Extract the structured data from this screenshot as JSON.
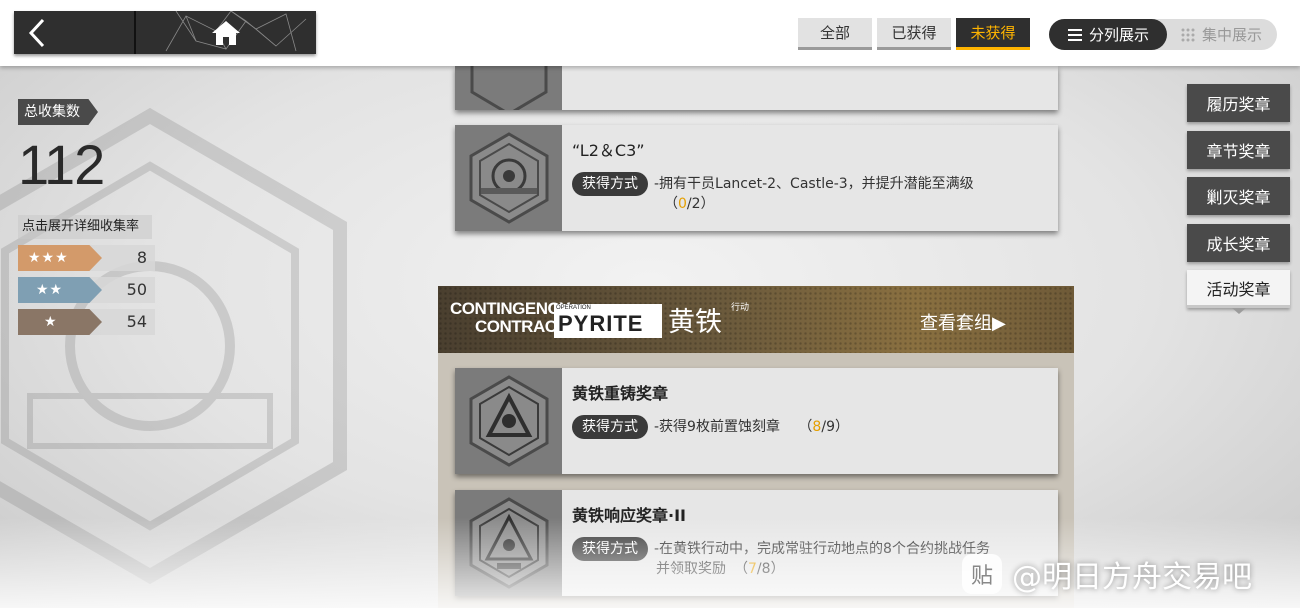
{
  "topbar": {
    "filters": [
      {
        "label": "全部",
        "active": false
      },
      {
        "label": "已获得",
        "active": false
      },
      {
        "label": "未获得",
        "active": true
      }
    ],
    "view_modes": {
      "split": "分列展示",
      "collected": "集中展示"
    }
  },
  "stats": {
    "total_label": "总收集数",
    "total": "112",
    "detail_link": "点击展开详细收集率",
    "rarities": [
      {
        "stars": "★★★",
        "count": "8",
        "color": "#d39a6a"
      },
      {
        "stars": "★★",
        "count": "50",
        "color": "#7f9fb3"
      },
      {
        "stars": "★",
        "count": "54",
        "color": "#8a7666"
      }
    ]
  },
  "categories": [
    {
      "label": "履历奖章",
      "active": false
    },
    {
      "label": "章节奖章",
      "active": false
    },
    {
      "label": "剿灭奖章",
      "active": false
    },
    {
      "label": "成长奖章",
      "active": false
    },
    {
      "label": "活动奖章",
      "active": true
    }
  ],
  "medals_top": [
    {
      "title": "“L2＆C3”",
      "requirement_label": "获得方式",
      "requirement": "-拥有干员Lancet-2、Castle-3，并提升潜能至满级",
      "progress_current": "0",
      "progress_total": "2"
    }
  ],
  "group": {
    "title_en_line1": "CONTINGENCY",
    "title_en_line2": "CONTRACT",
    "operation_small": "OPERATION",
    "operation_name": "PYRITE",
    "operation_cn": "黄铁",
    "operation_cn_suffix": "行动",
    "view_set": "查看套组▶",
    "medals": [
      {
        "title": "黄铁重铸奖章",
        "requirement_label": "获得方式",
        "requirement": "-获得9枚前置蚀刻章",
        "progress_current": "8",
        "progress_total": "9"
      },
      {
        "title": "黄铁响应奖章·II",
        "requirement_label": "获得方式",
        "requirement_line1": "-在黄铁行动中，完成常驻行动地点的8个合约挑战任务",
        "requirement_line2": "并领取奖励",
        "progress_current": "7",
        "progress_total": "8"
      }
    ]
  },
  "watermark": {
    "icon": "贴",
    "text": "@明日方舟交易吧"
  }
}
